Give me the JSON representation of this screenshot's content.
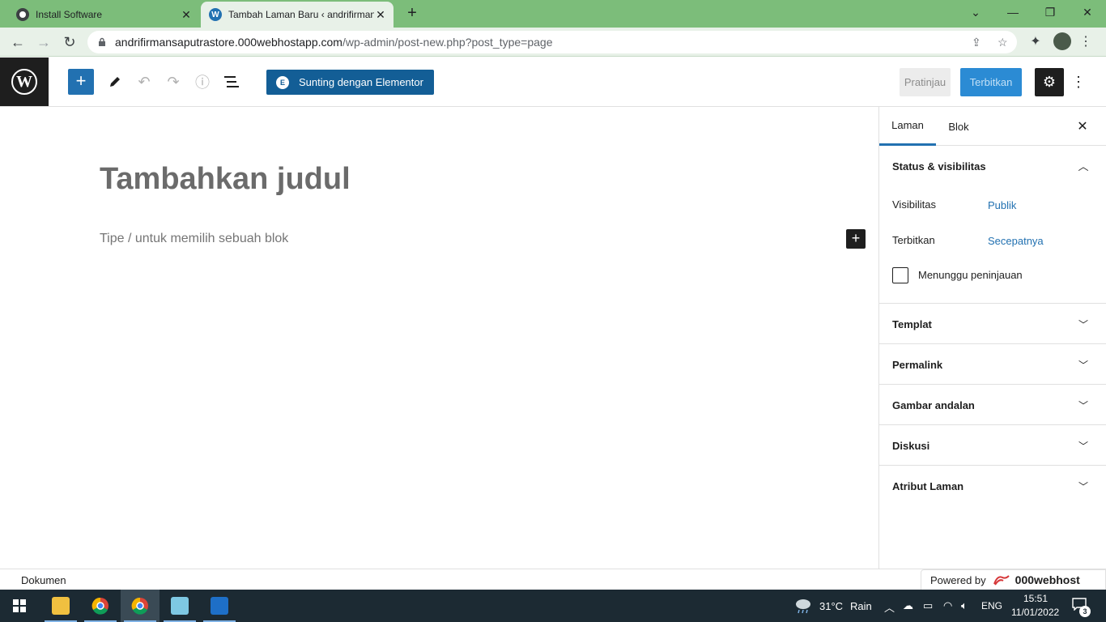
{
  "browser": {
    "tabs": [
      {
        "title": "Install Software",
        "icon": "github-icon"
      },
      {
        "title": "Tambah Laman Baru ‹ andrifirman",
        "icon": "wordpress-icon"
      }
    ],
    "url_host": "andrifirmansaputrastore.000webhostapp.com",
    "url_path": "/wp-admin/post-new.php?post_type=page"
  },
  "editor": {
    "elementor_label": "Sunting dengan Elementor",
    "preview_label": "Pratinjau",
    "publish_label": "Terbitkan",
    "title_placeholder": "Tambahkan judul",
    "block_placeholder": "Tipe / untuk memilih sebuah blok"
  },
  "sidebar": {
    "tabs": [
      "Laman",
      "Blok"
    ],
    "status_panel": {
      "title": "Status & visibilitas",
      "visibility_label": "Visibilitas",
      "visibility_value": "Publik",
      "publish_label": "Terbitkan",
      "publish_value": "Secepatnya",
      "pending_label": "Menunggu peninjauan"
    },
    "panels": [
      "Templat",
      "Permalink",
      "Gambar andalan",
      "Diskusi",
      "Atribut Laman"
    ]
  },
  "footer": {
    "breadcrumb": "Dokumen",
    "powered_by": "Powered by",
    "brand": "000webhost"
  },
  "taskbar": {
    "weather_temp": "31°C",
    "weather_desc": "Rain",
    "language": "ENG",
    "time": "15:51",
    "date": "11/01/2022",
    "notification_count": "3"
  },
  "colors": {
    "wp_blue": "#2271b1",
    "elementor_blue": "#135e96",
    "chrome_green": "#7cbd7a",
    "taskbar": "#1c2a33"
  }
}
